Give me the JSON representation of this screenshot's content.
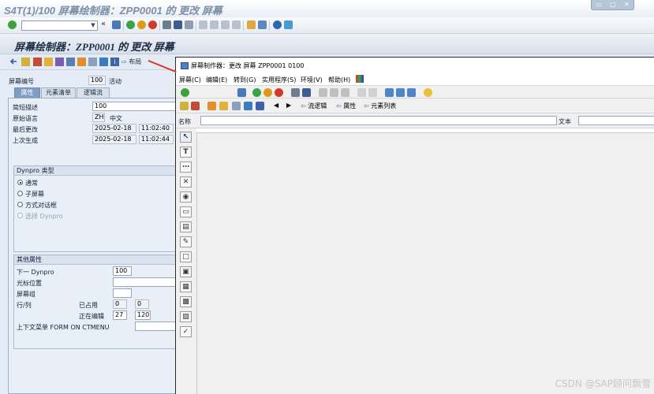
{
  "window": {
    "title": "S4T(1)/100 屏幕绘制器：ZPP0001 的 更改 屏幕",
    "controls": [
      "▭",
      "□",
      "✕"
    ]
  },
  "toolbar": {
    "command_field_value": "",
    "nav_back": "«"
  },
  "screen": {
    "title": "屏幕绘制器：ZPP0001 的 更改 屏幕"
  },
  "app_toolbar": {
    "layout_label": "布局"
  },
  "left": {
    "screen_number_label": "屏幕编号",
    "screen_number_value": "100",
    "status": "活动",
    "tabs": [
      "属性",
      "元素清单",
      "逻辑流"
    ],
    "attrs": {
      "short_desc_label": "简短描述",
      "short_desc_value": "100",
      "orig_lang_label": "原始语言",
      "orig_lang_code": "ZH",
      "orig_lang_name": "中文",
      "last_changed_label": "最后更改",
      "last_changed_date": "2025-02-18",
      "last_changed_time": "11:02:40",
      "last_gen_label": "上次生成",
      "last_gen_date": "2025-02-18",
      "last_gen_time": "11:02:44"
    },
    "dynpro_type": {
      "title": "Dynpro 类型",
      "options": [
        "通常",
        "子屏幕",
        "方式对话框",
        "选择 Dynpro"
      ],
      "selected": "通常"
    },
    "other": {
      "title": "其他属性",
      "next_dynpro_label": "下一 Dynpro",
      "next_dynpro_value": "100",
      "cursor_label": "光标位置",
      "screen_group_label": "屏幕组",
      "rowcol_label": "行/列",
      "occupied_label": "已占用",
      "occupied_row": "0",
      "occupied_col": "0",
      "editing_label": "正在编辑",
      "editing_row": "27",
      "editing_col": "120",
      "context_menu_label": "上下文菜单 FORM ON CTMENU"
    }
  },
  "painter": {
    "title": "屏幕制作器：更改 屏幕 ZPP0001 0100",
    "menu": [
      "屏幕(C)",
      "编辑(E)",
      "转到(G)",
      "实用程序(S)",
      "环境(V)",
      "帮助(H)"
    ],
    "buttons": {
      "flow_logic": "流逻辑",
      "attributes": "属性",
      "element_list": "元素列表"
    },
    "name_label": "名称",
    "text_label": "文本",
    "name_value": "",
    "text_value": ""
  },
  "watermark": "CSDN @SAP顾问飘雪",
  "colors": {
    "accent": "#7f9cc3",
    "panel_bg": "#e5ecf5",
    "header_title": "#1e2c44"
  }
}
